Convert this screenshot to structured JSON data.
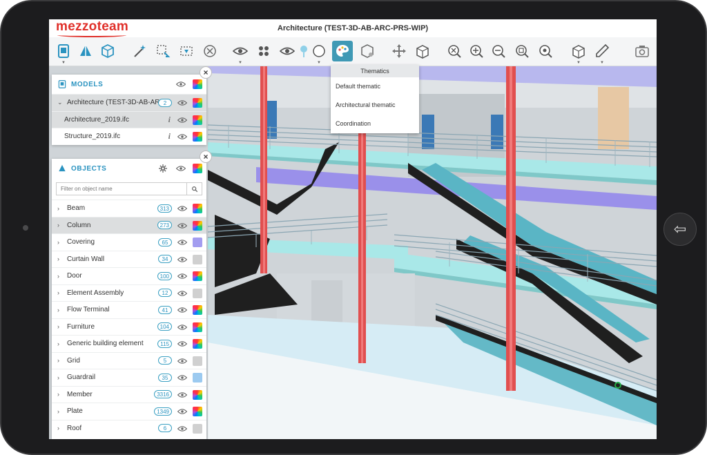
{
  "app": {
    "logo": "mezzoteam",
    "title": "Architecture (TEST-3D-AB-ARC-PRS-WIP)"
  },
  "toolbar": {
    "icons": [
      "model-icon",
      "objects-icon",
      "cube-icon",
      "magic-wand-icon",
      "box-select-icon",
      "clip-select-icon",
      "hide-icon",
      "eye-settings-icon",
      "eye-group-icon",
      "eye-filter-icon",
      "pin-icon",
      "sphere-icon",
      "palette-icon",
      "section-box-icon",
      "move-icon",
      "box-icon",
      "zoom-fit-icon",
      "zoom-in-icon",
      "zoom-out-icon",
      "zoom-window-icon",
      "zoom-selection-icon",
      "view-cube-icon",
      "measure-icon",
      "camera-icon"
    ],
    "active": "palette-icon"
  },
  "thematics": {
    "header": "Thematics",
    "items": [
      "Default thematic",
      "Architectural thematic",
      "Coordination"
    ]
  },
  "models": {
    "title": "MODELS",
    "group": {
      "label": "Architecture (TEST-3D-AB-AR...",
      "count": "2"
    },
    "files": [
      "Architecture_2019.ifc",
      "Structure_2019.ifc"
    ]
  },
  "objects": {
    "title": "OBJECTS",
    "filter_placeholder": "Filter on object name",
    "items": [
      {
        "label": "Beam",
        "count": "313",
        "color": "rainbow"
      },
      {
        "label": "Column",
        "count": "273",
        "color": "rainbow"
      },
      {
        "label": "Covering",
        "count": "65",
        "color": "#a39df0"
      },
      {
        "label": "Curtain Wall",
        "count": "34",
        "color": "#d0d0d0"
      },
      {
        "label": "Door",
        "count": "100",
        "color": "rainbow"
      },
      {
        "label": "Element Assembly",
        "count": "12",
        "color": "#d0d0d0"
      },
      {
        "label": "Flow Terminal",
        "count": "41",
        "color": "rainbow"
      },
      {
        "label": "Furniture",
        "count": "104",
        "color": "rainbow"
      },
      {
        "label": "Generic building element",
        "count": "115",
        "color": "rainbow"
      },
      {
        "label": "Grid",
        "count": "5",
        "color": "#d0d0d0"
      },
      {
        "label": "Guardrail",
        "count": "35",
        "color": "#9ccaf0"
      },
      {
        "label": "Member",
        "count": "3316",
        "color": "rainbow"
      },
      {
        "label": "Plate",
        "count": "1349",
        "color": "rainbow"
      },
      {
        "label": "Roof",
        "count": "6",
        "color": "#d0d0d0"
      }
    ]
  },
  "colors": {
    "accent": "#2a93c0",
    "logo": "#e0302a",
    "column": "#e04848",
    "glass": "#9fe0e0"
  }
}
